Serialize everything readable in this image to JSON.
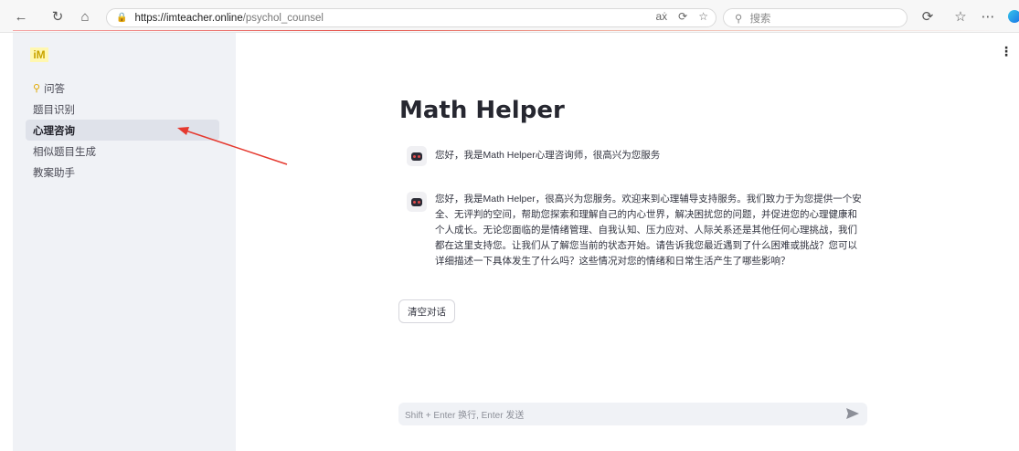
{
  "browser": {
    "url_domain": "https://imteacher.online",
    "url_path": "/psychol_counsel",
    "search_placeholder": "搜索"
  },
  "sidebar": {
    "logo": "iM",
    "items": [
      {
        "label": "问答",
        "icon": "key-icon"
      },
      {
        "label": "题目识别"
      },
      {
        "label": "心理咨询",
        "active": true
      },
      {
        "label": "相似题目生成"
      },
      {
        "label": "教案助手"
      }
    ]
  },
  "main": {
    "title": "Math Helper",
    "messages": [
      {
        "text": "您好，我是Math Helper心理咨询师，很高兴为您服务",
        "avatar": "robot-icon"
      },
      {
        "text": "您好，我是Math Helper，很高兴为您服务。欢迎来到心理辅导支持服务。我们致力于为您提供一个安全、无评判的空间，帮助您探索和理解自己的内心世界，解决困扰您的问题，并促进您的心理健康和个人成长。无论您面临的是情绪管理、自我认知、压力应对、人际关系还是其他任何心理挑战，我们都在这里支持您。让我们从了解您当前的状态开始。请告诉我您最近遇到了什么困难或挑战？您可以详细描述一下具体发生了什么吗？这些情况对您的情绪和日常生活产生了哪些影响？",
        "avatar": "robot-icon"
      }
    ],
    "clear_button": "清空对话",
    "input_placeholder": "Shift + Enter 换行, Enter 发送"
  },
  "colors": {
    "sidebar_bg": "#f0f2f6",
    "annotation_arrow": "#e5392f"
  }
}
